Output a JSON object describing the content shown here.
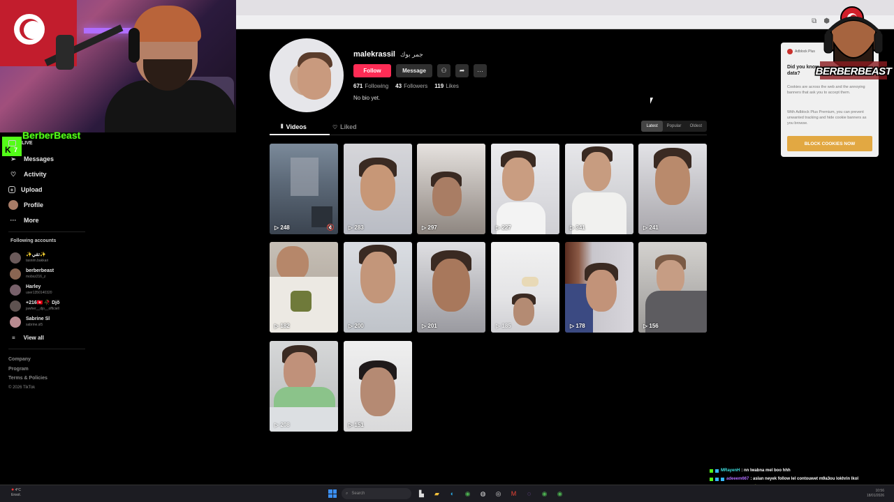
{
  "stream": {
    "streamer_name": "BerberBeast",
    "kick_badge": "K",
    "kick_count": "7",
    "logo_text": "BERBERBEAST"
  },
  "sidebar": {
    "items": [
      {
        "label": "LIVE",
        "icon": "live-icon"
      },
      {
        "label": "Messages",
        "icon": "message-icon"
      },
      {
        "label": "Activity",
        "icon": "activity-icon"
      },
      {
        "label": "Upload",
        "icon": "plus-square-icon"
      },
      {
        "label": "Profile",
        "icon": "avatar"
      },
      {
        "label": "More",
        "icon": "more-icon"
      }
    ],
    "following_title": "Following accounts",
    "following": [
      {
        "name": "✨تقي✨",
        "handle": "tasnim.bakkari",
        "color": "#6b5a5a"
      },
      {
        "name": "berberbeast",
        "handle": "mobxz216_z",
        "color": "#8a6552"
      },
      {
        "name": "Harley",
        "handle": "user1350140320",
        "color": "#77606a"
      },
      {
        "name": "+216🇹🇳 🥀 Djõ",
        "handle": "jawher__djo__officiell",
        "color": "#5e5250"
      },
      {
        "name": "Sabrine Sl",
        "handle": "sabrine.sl5",
        "color": "#b88a90"
      }
    ],
    "view_all": "View all",
    "footer": [
      "Company",
      "Program",
      "Terms & Policies",
      "© 2026 TikTok"
    ]
  },
  "profile": {
    "username": "malekrassil",
    "display_name": "جمر بوك",
    "follow_label": "Follow",
    "message_label": "Message",
    "following_count": "671",
    "following_label": "Following",
    "followers_count": "43",
    "followers_label": "Followers",
    "likes_count": "119",
    "likes_label": "Likes",
    "bio": "No bio yet.",
    "tabs": {
      "videos": "Videos",
      "liked": "Liked"
    },
    "sort": [
      "Latest",
      "Popular",
      "Oldest"
    ],
    "sort_active": "Latest"
  },
  "videos": [
    {
      "views": "248"
    },
    {
      "views": "283"
    },
    {
      "views": "297"
    },
    {
      "views": "227"
    },
    {
      "views": "341"
    },
    {
      "views": "241"
    },
    {
      "views": "182"
    },
    {
      "views": "200"
    },
    {
      "views": "201"
    },
    {
      "views": "185"
    },
    {
      "views": "178"
    },
    {
      "views": "156"
    },
    {
      "views": "208"
    },
    {
      "views": "151"
    }
  ],
  "adblock": {
    "brand": "Adblock Plus",
    "title": "Did you know data?",
    "p1": "Cookies are across the web and the annoying banners that ask you to accept them.",
    "p2": "With Adblock Plus Premium, you can prevent unwanted tracking and hide cookie banners as you browse.",
    "button": "BLOCK COOKIES NOW"
  },
  "chat": [
    {
      "user": "MRayenH",
      "msg": ": nn lwabna mel boo hhh",
      "color": "cyan"
    },
    {
      "user": "adeeem667",
      "msg": ": aslan neyek follow lel contouwet m9a3ou lokhrin lkol",
      "color": "purple"
    },
    {
      "user": "adeeem667",
      "msg": ": 🥀",
      "color": "orange"
    }
  ],
  "taskbar": {
    "temp": "4°C",
    "weather": "Ensol.",
    "search": "Search",
    "time": "10:56",
    "date": "18/01/2026"
  }
}
